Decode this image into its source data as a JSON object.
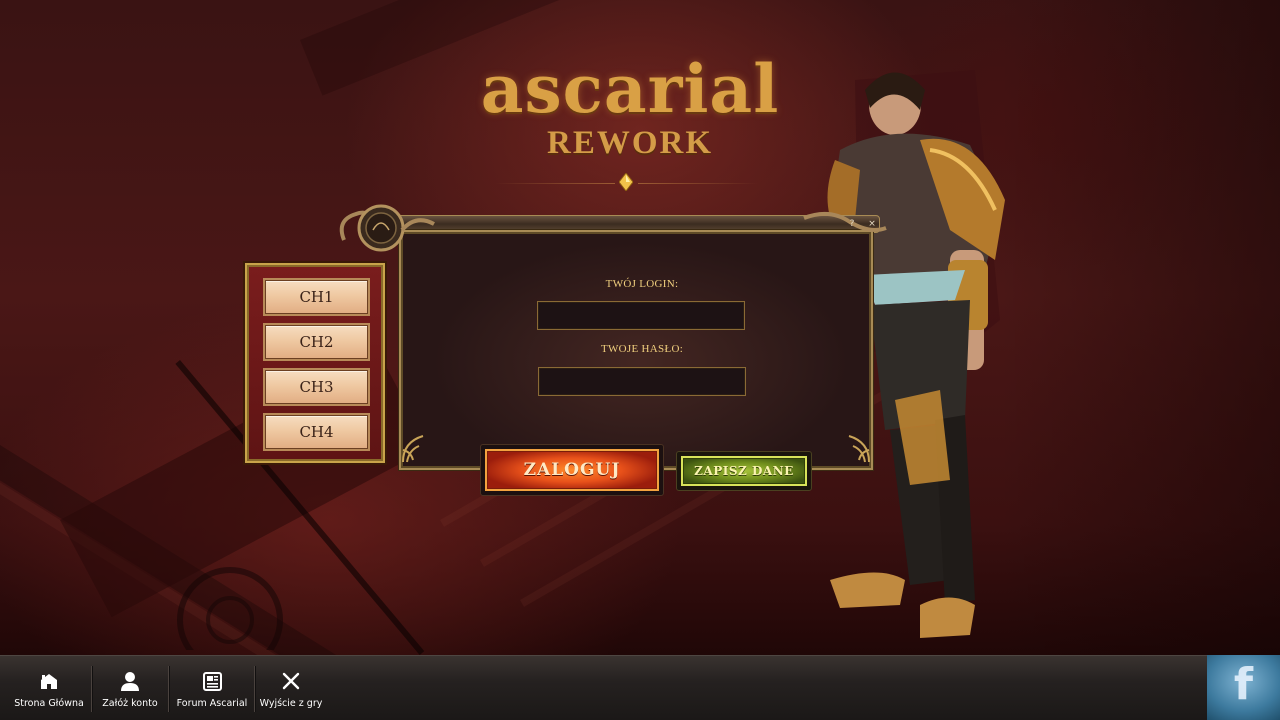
{
  "logo": {
    "title": "ascarial",
    "subtitle": "REWORK"
  },
  "channels": [
    {
      "label": "CH1"
    },
    {
      "label": "CH2"
    },
    {
      "label": "CH3"
    },
    {
      "label": "CH4"
    }
  ],
  "login_form": {
    "login_label": "TWÓJ LOGIN:",
    "login_value": "",
    "password_label": "TWOJE HASŁO:",
    "password_value": "",
    "login_button": "ZALOGUJ",
    "save_button": "ZAPISZ DANE",
    "help_glyph": "?",
    "close_glyph": "×"
  },
  "bottom_nav": [
    {
      "label": "Strona Główna",
      "icon": "home-icon"
    },
    {
      "label": "Załóż konto",
      "icon": "user-icon"
    },
    {
      "label": "Forum Ascarial",
      "icon": "newspaper-icon"
    },
    {
      "label": "Wyjście z gry",
      "icon": "close-icon"
    }
  ],
  "facebook": {
    "glyph": "f",
    "icon": "facebook-icon"
  },
  "colors": {
    "accent_gold": "#d9a045",
    "login_button": "#e8511a",
    "save_button": "#6f8d1c",
    "channel_panel": "#7a1d1d"
  }
}
